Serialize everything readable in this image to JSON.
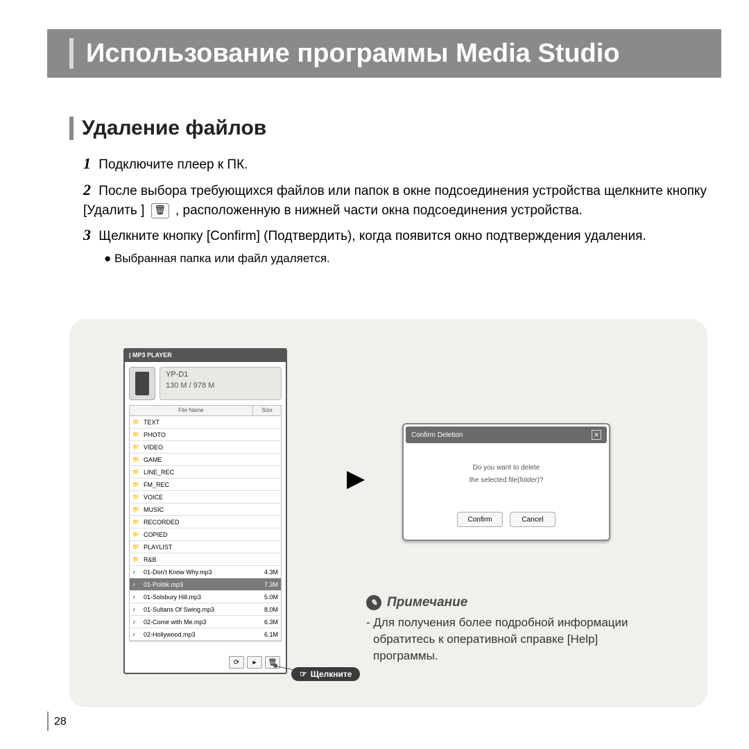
{
  "header": {
    "title": "Использование программы Media Studio"
  },
  "section": {
    "title": "Удаление файлов"
  },
  "steps": {
    "s1": "Подключите плеер к ПК.",
    "s2a": "После выбора требующихся файлов или папок в окне подсоединения устройства щелкните кнопку [Удалить ]",
    "s2b": ",  расположенную в нижней части окна подсоединения устройства.",
    "s3": "Щелкните кнопку [Confirm] (Подтвердить), когда появится окно подтверждения удаления.",
    "bullet": "Выбранная папка или файл удаляется."
  },
  "app": {
    "title": "| MP3 PLAYER",
    "device_name": "YP-D1",
    "device_mem": "130 M / 978 M",
    "header_name": "File Name",
    "header_size": "Size",
    "files": [
      {
        "n": "TEXT",
        "s": "",
        "t": "folder"
      },
      {
        "n": "PHOTO",
        "s": "",
        "t": "folder"
      },
      {
        "n": "VIDEO",
        "s": "",
        "t": "folder"
      },
      {
        "n": "GAME",
        "s": "",
        "t": "folder"
      },
      {
        "n": "LINE_REC",
        "s": "",
        "t": "folder"
      },
      {
        "n": "FM_REC",
        "s": "",
        "t": "folder"
      },
      {
        "n": "VOICE",
        "s": "",
        "t": "folder"
      },
      {
        "n": "MUSIC",
        "s": "",
        "t": "folder"
      },
      {
        "n": "RECORDED",
        "s": "",
        "t": "folder"
      },
      {
        "n": "COPIED",
        "s": "",
        "t": "folder"
      },
      {
        "n": "PLAYLIST",
        "s": "",
        "t": "folder"
      },
      {
        "n": "R&B",
        "s": "",
        "t": "folder"
      },
      {
        "n": "01-Don't Know Why.mp3",
        "s": "4.3M",
        "t": "file"
      },
      {
        "n": "01-Politik.mp3",
        "s": "7.3M",
        "t": "file",
        "sel": true
      },
      {
        "n": "01-Solsbury Hill.mp3",
        "s": "5.0M",
        "t": "file"
      },
      {
        "n": "01-Sultans Of Swing.mp3",
        "s": "8.0M",
        "t": "file"
      },
      {
        "n": "02-Come with Me.mp3",
        "s": "6.3M",
        "t": "file"
      },
      {
        "n": "02-Hollywood.mp3",
        "s": "6.1M",
        "t": "file"
      }
    ]
  },
  "dialog": {
    "title": "Confirm Deletion",
    "line1": "Do you want to delete",
    "line2": "the selected file(folder)?",
    "confirm": "Confirm",
    "cancel": "Cancel"
  },
  "click_label": "Щелкните",
  "note": {
    "heading": "Примечание",
    "text": "- Для получения более подробной информации обратитесь к оперативной справке [Help] программы."
  },
  "page": "28"
}
